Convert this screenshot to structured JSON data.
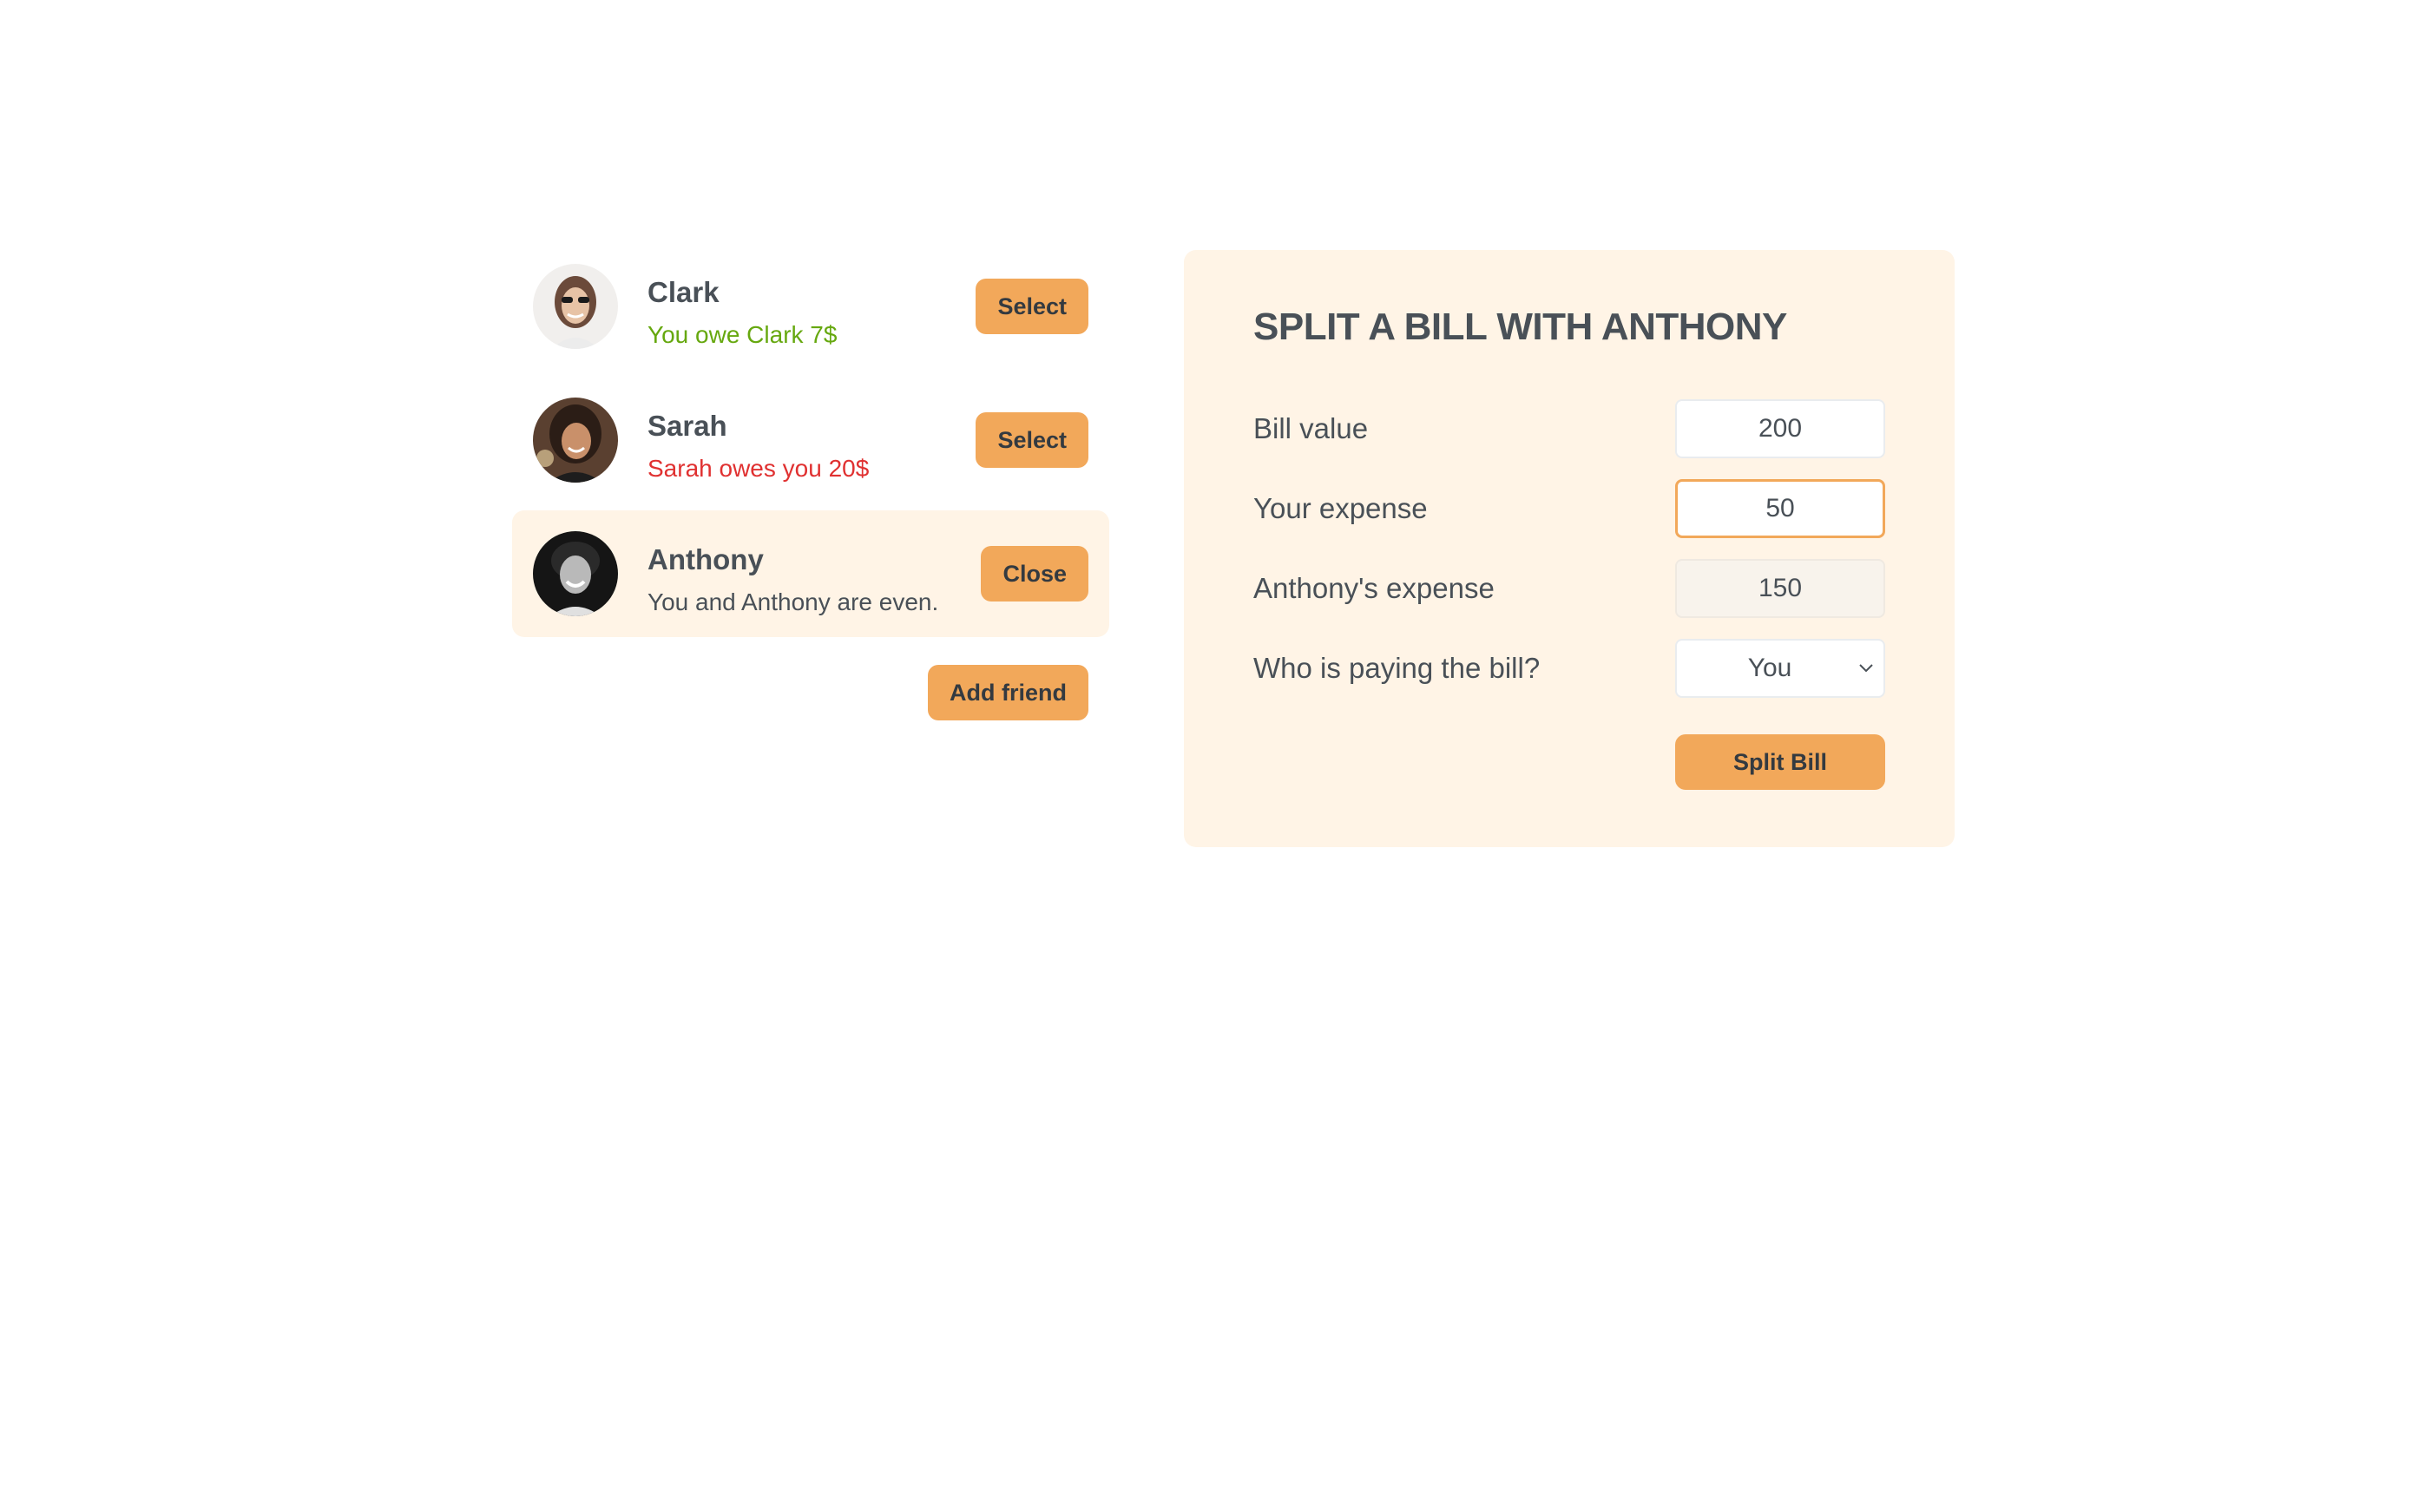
{
  "friends": [
    {
      "name": "Clark",
      "balance": "You owe Clark 7$",
      "balance_color": "#66a80f",
      "button_label": "Select",
      "selected": false
    },
    {
      "name": "Sarah",
      "balance": "Sarah owes you 20$",
      "balance_color": "#e03131",
      "button_label": "Select",
      "selected": false
    },
    {
      "name": "Anthony",
      "balance": "You and Anthony are even.",
      "balance_color": "#495057",
      "button_label": "Close",
      "selected": true
    }
  ],
  "add_friend_label": "Add friend",
  "form": {
    "title": "SPLIT A BILL WITH ANTHONY",
    "bill_value_label": "Bill value",
    "bill_value": "200",
    "your_expense_label": "Your expense",
    "your_expense": "50",
    "friend_expense_label": "Anthony's expense",
    "friend_expense": "150",
    "payer_label": "Who is paying the bill?",
    "payer_value": "You",
    "submit_label": "Split Bill"
  },
  "colors": {
    "accent": "#f2a85a",
    "panel_bg": "#fff4e6",
    "text": "#495057",
    "owe_positive": "#66a80f",
    "owe_negative": "#e03131"
  }
}
